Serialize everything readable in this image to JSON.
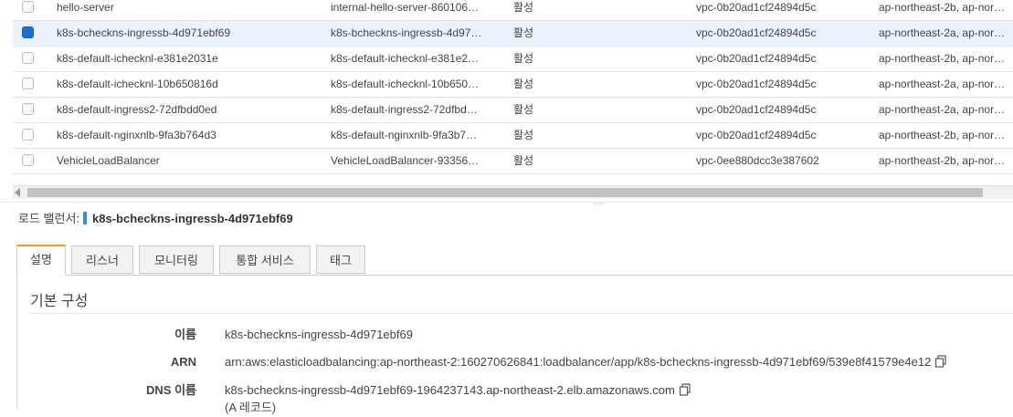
{
  "table": {
    "rows": [
      {
        "name": "hello-server",
        "dns": "internal-hello-server-860106…",
        "state": "활성",
        "vpc": "vpc-0b20ad1cf24894d5c",
        "az": "ap-northeast-2b, ap-nor…",
        "selected": false
      },
      {
        "name": "k8s-bcheckns-ingressb-4d971ebf69",
        "dns": "k8s-bcheckns-ingressb-4d97…",
        "state": "활성",
        "vpc": "vpc-0b20ad1cf24894d5c",
        "az": "ap-northeast-2a, ap-nor…",
        "selected": true
      },
      {
        "name": "k8s-default-icheckn​l-e381e2031e",
        "dns": "k8s-default-icheckn​l-e381e2…",
        "state": "활성",
        "vpc": "vpc-0b20ad1cf24894d5c",
        "az": "ap-northeast-2b, ap-nor…",
        "selected": false
      },
      {
        "name": "k8s-default-icheckn​l-10b650816d",
        "dns": "k8s-default-icheckn​l-10b650…",
        "state": "활성",
        "vpc": "vpc-0b20ad1cf24894d5c",
        "az": "ap-northeast-2a, ap-nor…",
        "selected": false
      },
      {
        "name": "k8s-default-ingress2-72dfbdd0ed",
        "dns": "k8s-default-ingress2-72dfbd…",
        "state": "활성",
        "vpc": "vpc-0b20ad1cf24894d5c",
        "az": "ap-northeast-2a, ap-nor…",
        "selected": false
      },
      {
        "name": "k8s-default-nginxnlb-9fa3b764d3",
        "dns": "k8s-default-nginxnlb-9fa3b7…",
        "state": "활성",
        "vpc": "vpc-0b20ad1cf24894d5c",
        "az": "ap-northeast-2b, ap-nor…",
        "selected": false
      },
      {
        "name": "VehicleLoadBalancer",
        "dns": "VehicleLoadBalancer-93356…",
        "state": "활성",
        "vpc": "vpc-0ee880dcc3e387602",
        "az": "ap-northeast-2b, ap-nor…",
        "selected": false
      }
    ]
  },
  "detail": {
    "label": "로드 밸런서:",
    "name": "k8s-bcheckns-ingressb-4d971ebf69",
    "accent_color": "#3b8fd8"
  },
  "tabs": [
    "설명",
    "리스너",
    "모니터링",
    "통합 서비스",
    "태그"
  ],
  "active_tab": "설명",
  "section": {
    "title": "기본 구성",
    "fields": [
      {
        "label": "이름",
        "value": "k8s-bcheckns-ingressb-4d971ebf69",
        "copy": false
      },
      {
        "label": "ARN",
        "value": "arn:aws:elasticloadbalancing:ap-northeast-2:160270626841:loadbalancer/app/k8s-bcheckns-ingressb-4d971ebf69/539e8f41579e4e12",
        "copy": true
      },
      {
        "label": "DNS 이름",
        "value": "k8s-bcheckns-ingressb-4d971ebf69-1964237143.ap-northeast-2.elb.amazonaws.com",
        "copy": true
      },
      {
        "label": "",
        "value": "(A 레코드)",
        "copy": false
      }
    ]
  },
  "icons": {
    "copy": "copy-icon",
    "grip": "drag-handle-icon",
    "scroll_left": "arrow-left-icon"
  },
  "colors": {
    "selected_row": "#eaf3fc",
    "checkbox_selected": "#1f6fd1",
    "active_tab_top": "#f39c12"
  }
}
